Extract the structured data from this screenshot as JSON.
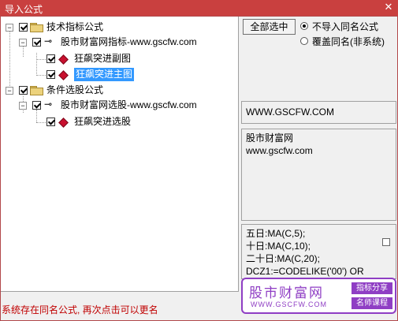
{
  "window": {
    "title": "导入公式",
    "close": "✕"
  },
  "tree": {
    "groups": [
      {
        "label": "技术指标公式",
        "source": "股市财富网指标-www.gscfw.com",
        "items": [
          "狂飙突进副图",
          "狂飙突进主图"
        ],
        "selected_item": "狂飙突进主图"
      },
      {
        "label": "条件选股公式",
        "source": "股市财富网选股-www.gscfw.com",
        "items": [
          "狂飙突进选股"
        ]
      }
    ]
  },
  "controls": {
    "select_all_label": "全部选中",
    "radio_options": [
      {
        "label": "不导入同名公式",
        "selected": true
      },
      {
        "label": "覆盖同名(非系统)",
        "selected": false
      }
    ]
  },
  "info": {
    "url_box": "WWW.GSCFW.COM",
    "author_lines": [
      "股市财富网",
      "www.gscfw.com"
    ]
  },
  "formula_preview": {
    "lines": [
      "五日:MA(C,5);",
      "十日:MA(C,10);",
      "二十日:MA(C,20);",
      "DCZ1:=CODELIKE('00') OR"
    ]
  },
  "status_text": "系统存在同名公式, 再次点击可以更名",
  "watermark": {
    "title": "股市财富网",
    "url": "WWW.GSCFW.COM",
    "tag1": "指标分享",
    "tag2": "名师课程"
  },
  "colors": {
    "title_bar": "#c9403f",
    "status": "#c00000",
    "selection": "#3399ff",
    "watermark": "#8f3ec4"
  }
}
